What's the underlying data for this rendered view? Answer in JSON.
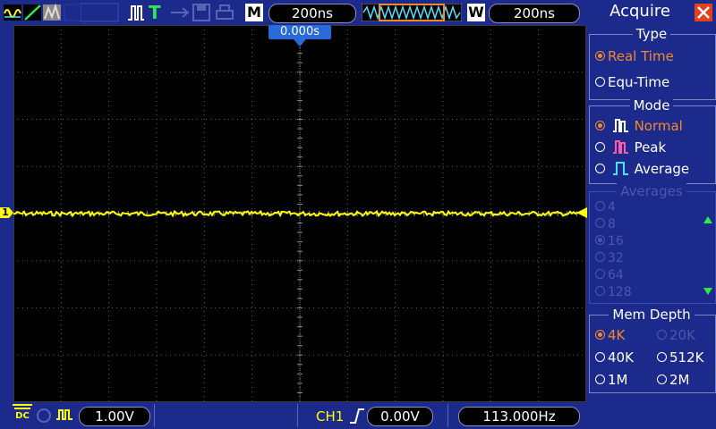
{
  "topbar": {
    "math_label": "M",
    "timebase": "200ns",
    "window_label": "W",
    "window_timebase": "200ns",
    "trigger_mode_label": "T"
  },
  "screen": {
    "trigger_time": "0.000s",
    "channel_marker": "1"
  },
  "bottombar": {
    "coupling": "DC",
    "volts_div": "1.00V",
    "trigger_source": "CH1",
    "trigger_level": "0.00V",
    "frequency": "113.000Hz"
  },
  "panel": {
    "title": "Acquire",
    "type": {
      "header": "Type",
      "options": [
        {
          "label": "Real Time",
          "selected": true
        },
        {
          "label": "Equ-Time",
          "selected": false
        }
      ]
    },
    "mode": {
      "header": "Mode",
      "options": [
        {
          "label": "Normal",
          "selected": true,
          "icon": "normal-pulse-icon"
        },
        {
          "label": "Peak",
          "selected": false,
          "icon": "peak-pulse-icon"
        },
        {
          "label": "Average",
          "selected": false,
          "icon": "average-pulse-icon"
        }
      ]
    },
    "averages": {
      "header": "Averages",
      "options": [
        "4",
        "8",
        "16",
        "32",
        "64",
        "128"
      ],
      "selected": "16"
    },
    "mem_depth": {
      "header": "Mem Depth",
      "options": [
        "4K",
        "20K",
        "40K",
        "512K",
        "1M",
        "2M"
      ],
      "selected": "4K"
    }
  },
  "colors": {
    "frame": "#1c2a8c",
    "trace": "#ffff00",
    "selected": "#f08a30",
    "close": "#e2411c"
  }
}
